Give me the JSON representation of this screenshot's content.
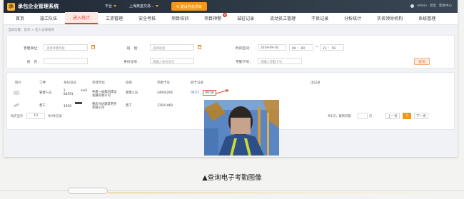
{
  "topbar": {
    "title": "承包企业管理系统",
    "platform_label": "平台",
    "company": "上海奥金交易...",
    "orange_button": "※ 建设信息项目",
    "user": "admin",
    "link1": "退出",
    "link2": "帮助中心"
  },
  "nav": {
    "items": [
      "首页",
      "施工队伍",
      "进入统计",
      "工资管理",
      "安全考核",
      "项目培训",
      "项目预警",
      "诚征记录",
      "流动员工管理",
      "不良记录",
      "分析统计",
      "实名领导机构",
      "系统管理"
    ],
    "active_index": 2,
    "badge_text": "8"
  },
  "breadcrumb": "当前位置：首页 > 出入记录查询",
  "filters": {
    "unit_label": "参建单位：",
    "unit_placeholder": "选择参建单位",
    "team_label": "班　组：",
    "team_placeholder": "选择班组",
    "time_label": "时间区间：",
    "date_value": "2019-09-16",
    "time_start": "00 ： 00",
    "tilde": "~",
    "time_end": "23 ： 59",
    "name_label": "姓　名：",
    "name_placeholder": "",
    "id_label": "身份证号：",
    "id_placeholder": "请输入身份证号",
    "card_label": "考勤卡号：",
    "card_placeholder": "请输入考勤卡号",
    "search_button": "查询"
  },
  "table": {
    "headers": [
      "照片",
      "工种",
      "身份证号",
      "参建单位",
      "班组",
      "考勤卡号",
      "刷卡记录",
      "",
      "出记录"
    ],
    "rows": [
      {
        "type": "管理人员",
        "id1": "2",
        "id2": "84591",
        "unit_a": "sss2",
        "unit_b": "中建一局集团建设",
        "unit_c": "发展有限公司",
        "team": "管理人员",
        "card": "24044264",
        "t1": "08:57",
        "t2": "09:56"
      },
      {
        "type": "普工",
        "id1": "",
        "id2": "1929",
        "unit_a": "",
        "unit_b": "重庆兴达建筑劳务",
        "unit_c": "有限公司",
        "team": "普工",
        "card": "11541468",
        "t1": "",
        "t2": ""
      }
    ]
  },
  "pagination": {
    "left_text": "每页显示",
    "per_page": "10",
    "left_suffix": "共3条记录",
    "right_text": "共1页，跳转到第",
    "right_suffix": "页",
    "prev": "上一页",
    "current": "1",
    "next": "下一页"
  },
  "photo_alt": "工人考勤照片",
  "caption": "▲查询电子考勤图像",
  "colors": {
    "accent": "#e8432a",
    "orange": "#f29a18",
    "topbar": "#2a3440"
  }
}
